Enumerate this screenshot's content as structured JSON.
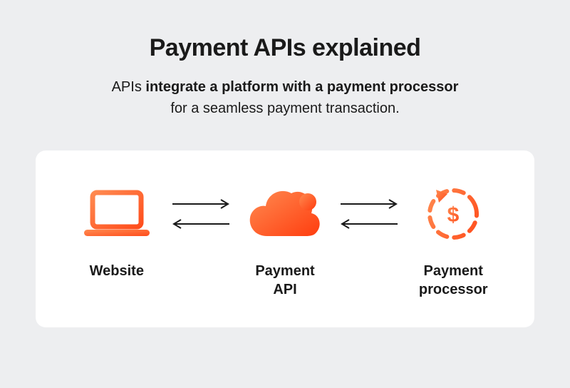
{
  "title": "Payment APIs explained",
  "subtitle": {
    "lead": "APIs ",
    "bold": "integrate a platform with a payment processor",
    "tail": "for a seamless payment transaction."
  },
  "nodes": {
    "website": "Website",
    "api": "Payment\nAPI",
    "processor": "Payment\nprocessor"
  },
  "colors": {
    "orange_light": "#ff7a45",
    "orange_dark": "#ff4d1c"
  }
}
